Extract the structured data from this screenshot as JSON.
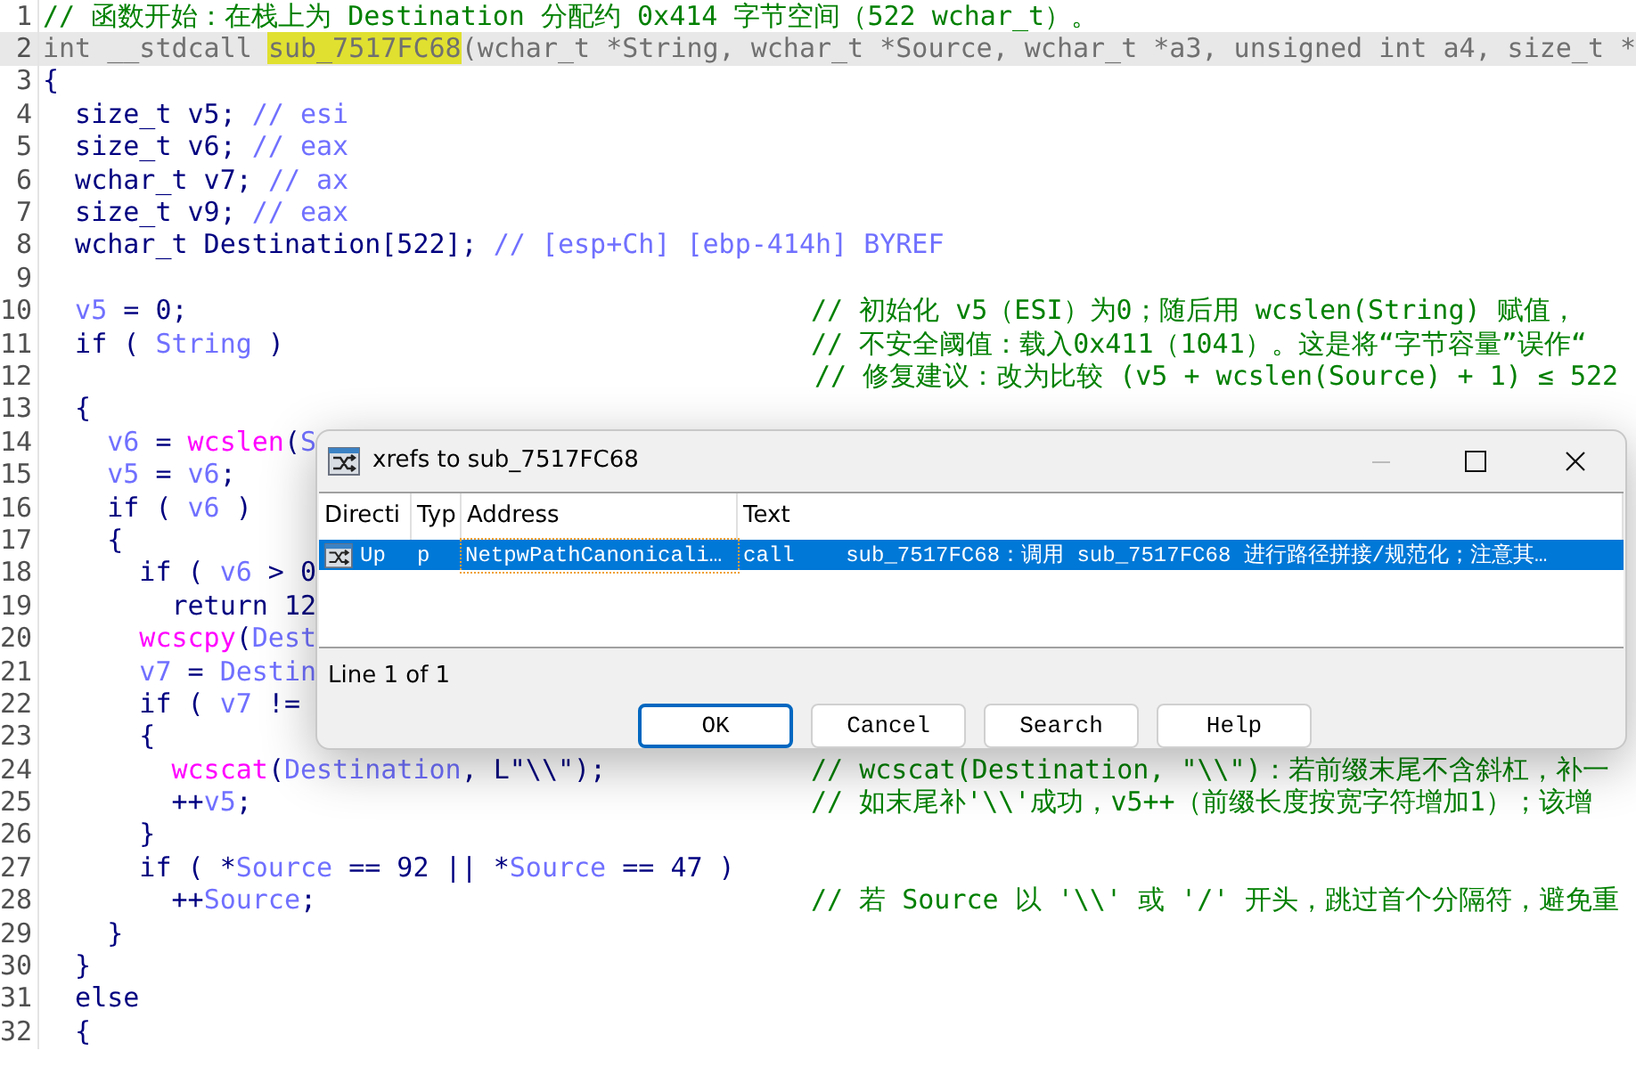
{
  "code_lines": [
    {
      "number": "1",
      "current": false,
      "comment": "// 函数开始：在栈上为 Destination 分配约 0x414 字节空间（522 wchar_t）。"
    },
    {
      "number": "2",
      "current": true,
      "code": [
        {
          "kind": "gray",
          "text": "int __stdcall "
        },
        {
          "kind": "highlight",
          "text": "sub_7517FC68"
        },
        {
          "kind": "gray",
          "text": "(wchar_t *String, wchar_t *Source, wchar_t *a3, unsigned int a4, size_t *"
        }
      ]
    },
    {
      "number": "3",
      "current": false,
      "code": [
        {
          "kind": "plain",
          "text": "{"
        }
      ]
    },
    {
      "number": "4",
      "current": false,
      "code": [
        {
          "kind": "plain",
          "text": "  size_t v5; "
        },
        {
          "kind": "var",
          "text": "// esi"
        }
      ]
    },
    {
      "number": "5",
      "current": false,
      "code": [
        {
          "kind": "plain",
          "text": "  size_t v6; "
        },
        {
          "kind": "var",
          "text": "// eax"
        }
      ]
    },
    {
      "number": "6",
      "current": false,
      "code": [
        {
          "kind": "plain",
          "text": "  wchar_t v7; "
        },
        {
          "kind": "var",
          "text": "// ax"
        }
      ]
    },
    {
      "number": "7",
      "current": false,
      "code": [
        {
          "kind": "plain",
          "text": "  size_t v9; "
        },
        {
          "kind": "var",
          "text": "// eax"
        }
      ]
    },
    {
      "number": "8",
      "current": false,
      "code": [
        {
          "kind": "plain",
          "text": "  wchar_t Destination[522]; "
        },
        {
          "kind": "var",
          "text": "// [esp+Ch] [ebp-414h] BYREF"
        }
      ]
    },
    {
      "number": "9",
      "current": false
    },
    {
      "number": "10",
      "current": false,
      "code": [
        {
          "kind": "var",
          "text": "  v5"
        },
        {
          "kind": "plain",
          "text": " = 0;"
        }
      ],
      "comment": "// 初始化 v5（ESI）为0；随后用 wcslen(String) 赋值，"
    },
    {
      "number": "11",
      "current": false,
      "code": [
        {
          "kind": "plain",
          "text": "  if ( "
        },
        {
          "kind": "var",
          "text": "String"
        },
        {
          "kind": "plain",
          "text": " )"
        }
      ],
      "comment": "// 不安全阈值：载入0x411（1041）。这是将“字节容量”误作“"
    },
    {
      "number": "12",
      "current": false,
      "comment": "// 修复建议：改为比较 (v5 + wcslen(Source) + 1) ≤ 522"
    },
    {
      "number": "13",
      "current": false,
      "code": [
        {
          "kind": "plain",
          "text": "  {"
        }
      ]
    },
    {
      "number": "14",
      "current": false,
      "code": [
        {
          "kind": "var",
          "text": "    v6"
        },
        {
          "kind": "plain",
          "text": " = "
        },
        {
          "kind": "func",
          "text": "wcslen"
        },
        {
          "kind": "plain",
          "text": "("
        },
        {
          "kind": "var",
          "text": "S"
        }
      ]
    },
    {
      "number": "15",
      "current": false,
      "code": [
        {
          "kind": "var",
          "text": "    v5"
        },
        {
          "kind": "plain",
          "text": " = "
        },
        {
          "kind": "var",
          "text": "v6"
        },
        {
          "kind": "plain",
          "text": ";"
        }
      ]
    },
    {
      "number": "16",
      "current": false,
      "code": [
        {
          "kind": "plain",
          "text": "    if ( "
        },
        {
          "kind": "var",
          "text": "v6"
        },
        {
          "kind": "plain",
          "text": " )"
        }
      ]
    },
    {
      "number": "17",
      "current": false,
      "code": [
        {
          "kind": "plain",
          "text": "    {"
        }
      ]
    },
    {
      "number": "18",
      "current": false,
      "code": [
        {
          "kind": "plain",
          "text": "      if ( "
        },
        {
          "kind": "var",
          "text": "v6"
        },
        {
          "kind": "plain",
          "text": " > 0"
        }
      ]
    },
    {
      "number": "19",
      "current": false,
      "code": [
        {
          "kind": "plain",
          "text": "        return 12"
        }
      ]
    },
    {
      "number": "20",
      "current": false,
      "code": [
        {
          "kind": "func",
          "text": "      wcscpy"
        },
        {
          "kind": "plain",
          "text": "("
        },
        {
          "kind": "var",
          "text": "Dest"
        }
      ]
    },
    {
      "number": "21",
      "current": false,
      "code": [
        {
          "kind": "var",
          "text": "      v7"
        },
        {
          "kind": "plain",
          "text": " = "
        },
        {
          "kind": "var",
          "text": "Destin"
        }
      ]
    },
    {
      "number": "22",
      "current": false,
      "code": [
        {
          "kind": "plain",
          "text": "      if ( "
        },
        {
          "kind": "var",
          "text": "v7"
        },
        {
          "kind": "plain",
          "text": " !="
        }
      ]
    },
    {
      "number": "23",
      "current": false,
      "code": [
        {
          "kind": "plain",
          "text": "      {"
        }
      ]
    },
    {
      "number": "24",
      "current": false,
      "code": [
        {
          "kind": "func",
          "text": "        wcscat"
        },
        {
          "kind": "plain",
          "text": "("
        },
        {
          "kind": "var",
          "text": "Destination"
        },
        {
          "kind": "plain",
          "text": ", L\"\\\\\");"
        }
      ],
      "comment": "// wcscat(Destination, \"\\\\\")：若前缀末尾不含斜杠，补一"
    },
    {
      "number": "25",
      "current": false,
      "code": [
        {
          "kind": "plain",
          "text": "        ++"
        },
        {
          "kind": "var",
          "text": "v5"
        },
        {
          "kind": "plain",
          "text": ";"
        }
      ],
      "comment": "// 如末尾补'\\\\'成功，v5++（前缀长度按宽字符增加1）；该增"
    },
    {
      "number": "26",
      "current": false,
      "code": [
        {
          "kind": "plain",
          "text": "      }"
        }
      ]
    },
    {
      "number": "27",
      "current": false,
      "code": [
        {
          "kind": "plain",
          "text": "      if ( *"
        },
        {
          "kind": "var",
          "text": "Source"
        },
        {
          "kind": "plain",
          "text": " == 92 || *"
        },
        {
          "kind": "var",
          "text": "Source"
        },
        {
          "kind": "plain",
          "text": " == 47 )"
        }
      ]
    },
    {
      "number": "28",
      "current": false,
      "code": [
        {
          "kind": "plain",
          "text": "        ++"
        },
        {
          "kind": "var",
          "text": "Source"
        },
        {
          "kind": "plain",
          "text": ";"
        }
      ],
      "comment": "// 若 Source 以 '\\\\' 或 '/' 开头，跳过首个分隔符，避免重"
    },
    {
      "number": "29",
      "current": false,
      "code": [
        {
          "kind": "plain",
          "text": "    }"
        }
      ]
    },
    {
      "number": "30",
      "current": false,
      "code": [
        {
          "kind": "plain",
          "text": "  }"
        }
      ]
    },
    {
      "number": "31",
      "current": false,
      "code": [
        {
          "kind": "plain",
          "text": "  else"
        }
      ]
    },
    {
      "number": "32",
      "current": false,
      "code": [
        {
          "kind": "plain",
          "text": "  {"
        }
      ]
    }
  ],
  "dialog": {
    "title": "xrefs to sub_7517FC68",
    "columns": [
      "Directi",
      "Typ",
      "Address",
      "Text"
    ],
    "rows": [
      {
        "selected": true,
        "direction": "Up",
        "type": "p",
        "address": "NetpwPathCanonicali…",
        "text": "call    sub_7517FC68：调用 sub_7517FC68 进行路径拼接/规范化；注意其…"
      }
    ],
    "status": "Line 1 of 1",
    "buttons": [
      {
        "label": "OK",
        "focused": true
      },
      {
        "label": "Cancel",
        "focused": false
      },
      {
        "label": "Search",
        "focused": false
      },
      {
        "label": "Help",
        "focused": false
      }
    ]
  }
}
